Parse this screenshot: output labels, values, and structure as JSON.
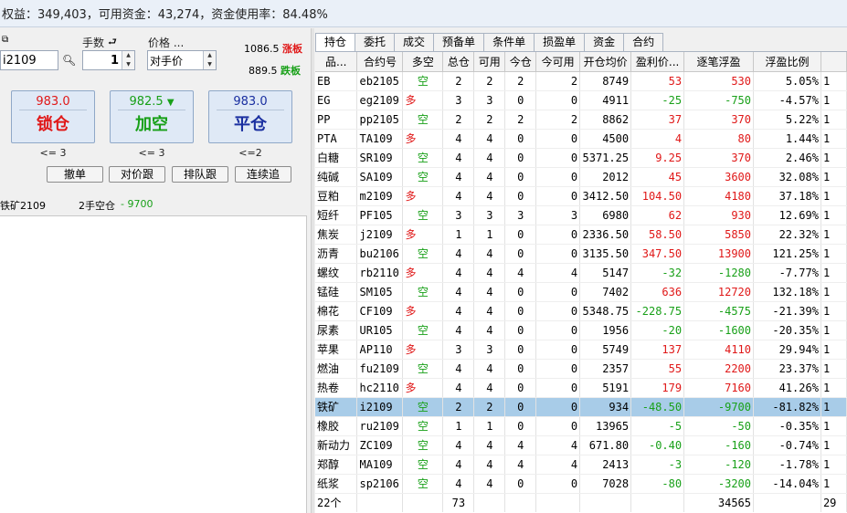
{
  "account": {
    "summary": "权益：349,403，可用资金：43,274，资金使用率：84.48%"
  },
  "order": {
    "contract": "i2109",
    "qty_label": "手数",
    "qty": "1",
    "price_label": "价格 ...",
    "price_mode": "对手价",
    "limit_up_value": "1086.5",
    "limit_up_label": "涨板",
    "limit_down_value": "889.5",
    "limit_down_label": "跌板",
    "buttons": [
      {
        "price": "983.0",
        "label": "锁仓",
        "limit": "<= 3",
        "price_color": "#e01818",
        "label_color": "#e01818"
      },
      {
        "price": "982.5",
        "label": "加空",
        "limit": "<= 3",
        "price_color": "#18a018",
        "label_color": "#18a018",
        "arrow": "▼"
      },
      {
        "price": "983.0",
        "label": "平仓",
        "limit": "<=2",
        "price_color": "#1a2fa0",
        "label_color": "#1a2fa0"
      }
    ],
    "actions": [
      "撤单",
      "对价跟",
      "排队跟",
      "连续追"
    ],
    "status_contract": "铁矿2109",
    "status_text": "2手空仓",
    "status_pnl": "- 9700"
  },
  "tabs": [
    "持仓",
    "委托",
    "成交",
    "预备单",
    "条件单",
    "损盈单",
    "资金",
    "合约"
  ],
  "positions": {
    "headers": [
      "品...",
      "合约号",
      "多空",
      "总仓",
      "可用",
      "今仓",
      "今可用",
      "开仓均价",
      "盈利价...",
      "逐笔浮盈",
      "浮盈比例"
    ],
    "rows": [
      {
        "name": "EB",
        "code": "eb2105",
        "dir": "空",
        "total": "2",
        "avail": "2",
        "today": "2",
        "today_avail": "2",
        "open": "8749",
        "pnl_price": "53",
        "float_pnl": "530",
        "ratio": "5.05%",
        "sign": "pos"
      },
      {
        "name": "EG",
        "code": "eg2109",
        "dir": "多",
        "total": "3",
        "avail": "3",
        "today": "0",
        "today_avail": "0",
        "open": "4911",
        "pnl_price": "-25",
        "float_pnl": "-750",
        "ratio": "-4.57%",
        "sign": "neg"
      },
      {
        "name": "PP",
        "code": "pp2105",
        "dir": "空",
        "total": "2",
        "avail": "2",
        "today": "2",
        "today_avail": "2",
        "open": "8862",
        "pnl_price": "37",
        "float_pnl": "370",
        "ratio": "5.22%",
        "sign": "pos"
      },
      {
        "name": "PTA",
        "code": "TA109",
        "dir": "多",
        "total": "4",
        "avail": "4",
        "today": "0",
        "today_avail": "0",
        "open": "4500",
        "pnl_price": "4",
        "float_pnl": "80",
        "ratio": "1.44%",
        "sign": "pos"
      },
      {
        "name": "白糖",
        "code": "SR109",
        "dir": "空",
        "total": "4",
        "avail": "4",
        "today": "0",
        "today_avail": "0",
        "open": "5371.25",
        "pnl_price": "9.25",
        "float_pnl": "370",
        "ratio": "2.46%",
        "sign": "pos"
      },
      {
        "name": "纯碱",
        "code": "SA109",
        "dir": "空",
        "total": "4",
        "avail": "4",
        "today": "0",
        "today_avail": "0",
        "open": "2012",
        "pnl_price": "45",
        "float_pnl": "3600",
        "ratio": "32.08%",
        "sign": "pos"
      },
      {
        "name": "豆粕",
        "code": "m2109",
        "dir": "多",
        "total": "4",
        "avail": "4",
        "today": "0",
        "today_avail": "0",
        "open": "3412.50",
        "pnl_price": "104.50",
        "float_pnl": "4180",
        "ratio": "37.18%",
        "sign": "pos"
      },
      {
        "name": "短纤",
        "code": "PF105",
        "dir": "空",
        "total": "3",
        "avail": "3",
        "today": "3",
        "today_avail": "3",
        "open": "6980",
        "pnl_price": "62",
        "float_pnl": "930",
        "ratio": "12.69%",
        "sign": "pos"
      },
      {
        "name": "焦炭",
        "code": "j2109",
        "dir": "多",
        "total": "1",
        "avail": "1",
        "today": "0",
        "today_avail": "0",
        "open": "2336.50",
        "pnl_price": "58.50",
        "float_pnl": "5850",
        "ratio": "22.32%",
        "sign": "pos"
      },
      {
        "name": "沥青",
        "code": "bu2106",
        "dir": "空",
        "total": "4",
        "avail": "4",
        "today": "0",
        "today_avail": "0",
        "open": "3135.50",
        "pnl_price": "347.50",
        "float_pnl": "13900",
        "ratio": "121.25%",
        "sign": "pos"
      },
      {
        "name": "螺纹",
        "code": "rb2110",
        "dir": "多",
        "total": "4",
        "avail": "4",
        "today": "4",
        "today_avail": "4",
        "open": "5147",
        "pnl_price": "-32",
        "float_pnl": "-1280",
        "ratio": "-7.77%",
        "sign": "neg"
      },
      {
        "name": "锰硅",
        "code": "SM105",
        "dir": "空",
        "total": "4",
        "avail": "4",
        "today": "0",
        "today_avail": "0",
        "open": "7402",
        "pnl_price": "636",
        "float_pnl": "12720",
        "ratio": "132.18%",
        "sign": "pos"
      },
      {
        "name": "棉花",
        "code": "CF109",
        "dir": "多",
        "total": "4",
        "avail": "4",
        "today": "0",
        "today_avail": "0",
        "open": "5348.75",
        "pnl_price": "-228.75",
        "float_pnl": "-4575",
        "ratio": "-21.39%",
        "sign": "neg"
      },
      {
        "name": "尿素",
        "code": "UR105",
        "dir": "空",
        "total": "4",
        "avail": "4",
        "today": "0",
        "today_avail": "0",
        "open": "1956",
        "pnl_price": "-20",
        "float_pnl": "-1600",
        "ratio": "-20.35%",
        "sign": "neg"
      },
      {
        "name": "苹果",
        "code": "AP110",
        "dir": "多",
        "total": "3",
        "avail": "3",
        "today": "0",
        "today_avail": "0",
        "open": "5749",
        "pnl_price": "137",
        "float_pnl": "4110",
        "ratio": "29.94%",
        "sign": "pos"
      },
      {
        "name": "燃油",
        "code": "fu2109",
        "dir": "空",
        "total": "4",
        "avail": "4",
        "today": "0",
        "today_avail": "0",
        "open": "2357",
        "pnl_price": "55",
        "float_pnl": "2200",
        "ratio": "23.37%",
        "sign": "pos"
      },
      {
        "name": "热卷",
        "code": "hc2110",
        "dir": "多",
        "total": "4",
        "avail": "4",
        "today": "0",
        "today_avail": "0",
        "open": "5191",
        "pnl_price": "179",
        "float_pnl": "7160",
        "ratio": "41.26%",
        "sign": "pos"
      },
      {
        "name": "铁矿",
        "code": "i2109",
        "dir": "空",
        "total": "2",
        "avail": "2",
        "today": "0",
        "today_avail": "0",
        "open": "934",
        "pnl_price": "-48.50",
        "float_pnl": "-9700",
        "ratio": "-81.82%",
        "sign": "neg",
        "selected": true
      },
      {
        "name": "橡胶",
        "code": "ru2109",
        "dir": "空",
        "total": "1",
        "avail": "1",
        "today": "0",
        "today_avail": "0",
        "open": "13965",
        "pnl_price": "-5",
        "float_pnl": "-50",
        "ratio": "-0.35%",
        "sign": "neg"
      },
      {
        "name": "新动力",
        "code": "ZC109",
        "dir": "空",
        "total": "4",
        "avail": "4",
        "today": "4",
        "today_avail": "4",
        "open": "671.80",
        "pnl_price": "-0.40",
        "float_pnl": "-160",
        "ratio": "-0.74%",
        "sign": "neg"
      },
      {
        "name": "郑醇",
        "code": "MA109",
        "dir": "空",
        "total": "4",
        "avail": "4",
        "today": "4",
        "today_avail": "4",
        "open": "2413",
        "pnl_price": "-3",
        "float_pnl": "-120",
        "ratio": "-1.78%",
        "sign": "neg"
      },
      {
        "name": "纸浆",
        "code": "sp2106",
        "dir": "空",
        "total": "4",
        "avail": "4",
        "today": "0",
        "today_avail": "0",
        "open": "7028",
        "pnl_price": "-80",
        "float_pnl": "-3200",
        "ratio": "-14.04%",
        "sign": "neg"
      }
    ],
    "total": {
      "count": "22个",
      "total": "73",
      "float_pnl": "34565",
      "extra": "29"
    }
  }
}
